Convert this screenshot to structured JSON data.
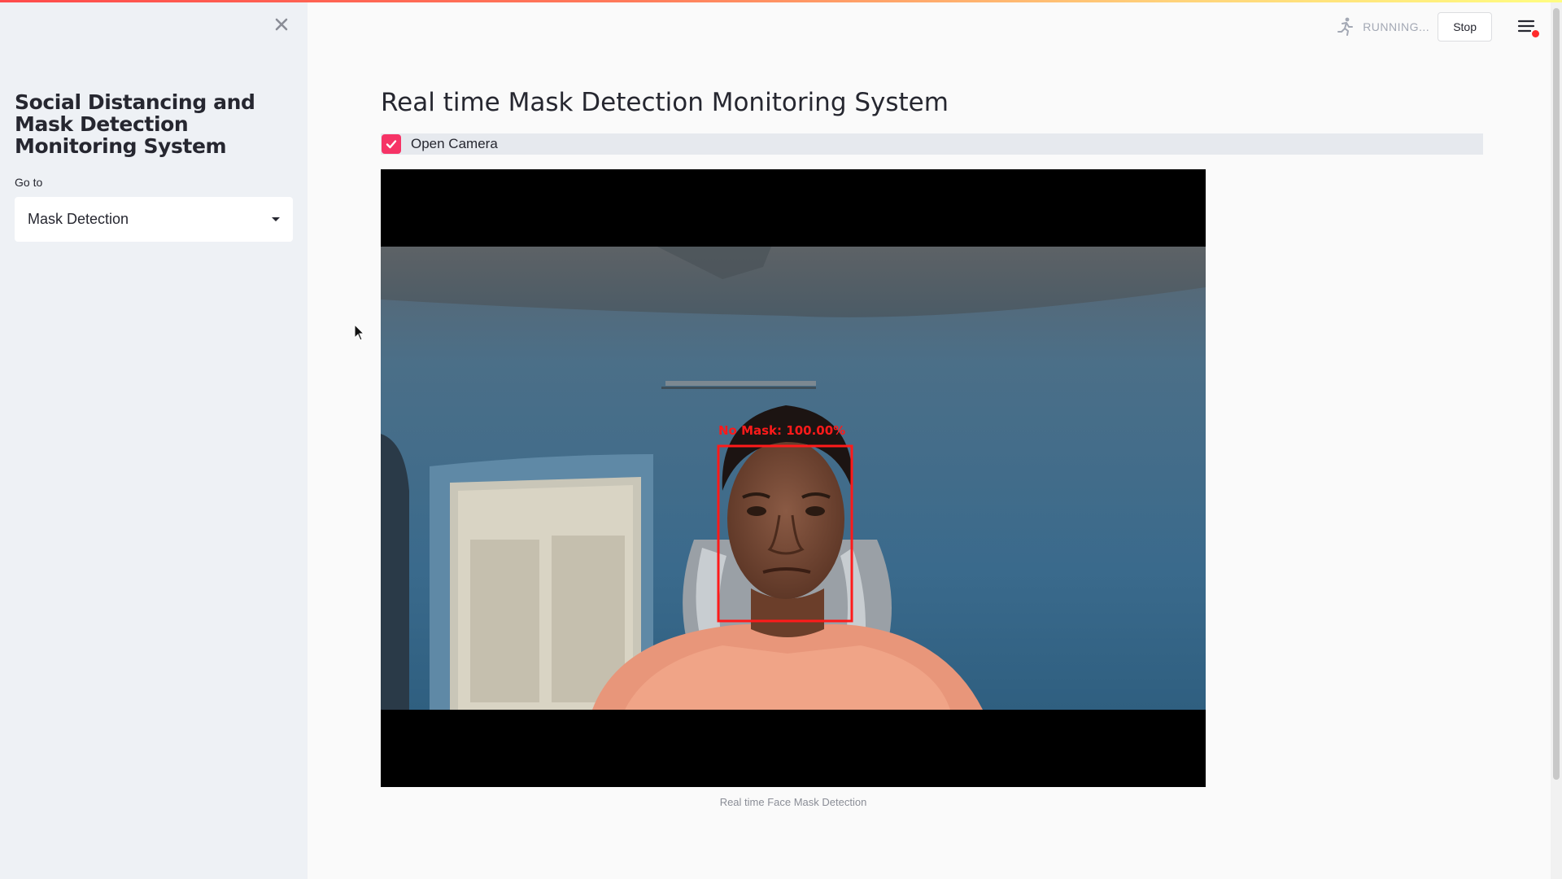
{
  "sidebar": {
    "title": "Social Distancing and Mask Detection Monitoring System",
    "goto_label": "Go to",
    "select_value": "Mask Detection"
  },
  "header": {
    "status": "RUNNING...",
    "stop_label": "Stop"
  },
  "main": {
    "title": "Real time Mask Detection Monitoring System",
    "checkbox_label": "Open Camera",
    "checkbox_checked": true,
    "video": {
      "detection_label": "No Mask: 100.00%",
      "caption": "Real time Face Mask Detection"
    }
  },
  "colors": {
    "accent": "#f63366",
    "detection_box": "#ff1a1a",
    "sidebar_bg": "#eef1f5",
    "main_bg": "#fafafa"
  },
  "icons": {
    "sidebar_close": "close-icon",
    "running": "running-man-icon",
    "menu": "hamburger-menu-icon",
    "checkbox": "checkmark-icon",
    "dropdown": "caret-down-icon"
  }
}
